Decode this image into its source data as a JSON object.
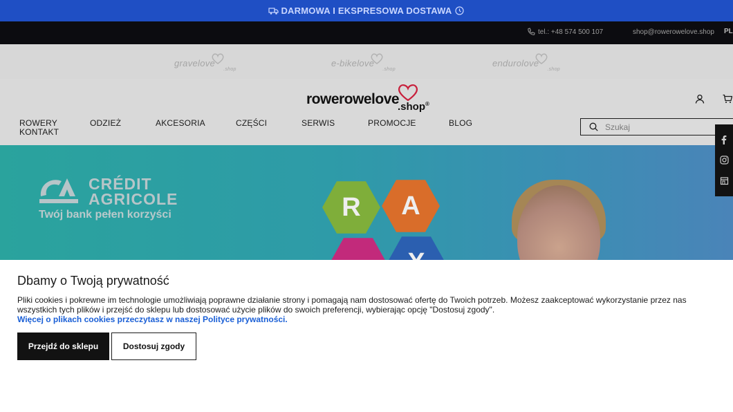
{
  "promo_bar": {
    "text": "DARMOWA I EKSPRESOWA DOSTAWA",
    "left_icon": "truck-icon",
    "right_icon": "clock-icon"
  },
  "contact_bar": {
    "phone": "tel.: +48 574 500 107",
    "email": "shop@rowerowelove.shop",
    "language": "PL"
  },
  "brands": [
    {
      "name": "gravelove",
      "suffix": ".shop"
    },
    {
      "name": "e-bikelove",
      "suffix": ".shop"
    },
    {
      "name": "endurolove",
      "suffix": ".shop"
    }
  ],
  "header": {
    "logo_text": "rowerowelove",
    "logo_suffix": ".shop",
    "logo_mark": "®",
    "account_icon": "user-icon",
    "cart_icon": "cart-icon"
  },
  "nav": {
    "rowery": "ROWERY",
    "kontakt": "KONTAKT",
    "odziez": "ODZIEŻ",
    "akcesoria": "AKCESORIA",
    "czesci": "CZĘŚCI",
    "serwis": "SERWIS",
    "promocje": "PROMOCJE",
    "blog": "BLOG"
  },
  "search": {
    "placeholder": "Szukaj"
  },
  "social": [
    "facebook-icon",
    "instagram-icon",
    "store-icon"
  ],
  "banner": {
    "brand_line1": "CRÉDIT",
    "brand_line2": "AGRICOLE",
    "tagline": "Twój bank pełen korzyści",
    "letters": [
      "R",
      "A",
      "",
      "X"
    ]
  },
  "cookie": {
    "title": "Dbamy o Twoją prywatność",
    "text": "Pliki cookies i pokrewne im technologie umożliwiają poprawne działanie strony i pomagają nam dostosować ofertę do Twoich potrzeb. Możesz zaakceptować wykorzystanie przez nas wszystkich tych plików i przejść do sklepu lub dostosować użycie plików do swoich preferencji, wybierając opcję \"Dostosuj zgody\".",
    "link": "Więcej o plikach cookies przeczytasz w naszej Polityce prywatności.",
    "accept_label": "Przejdź do sklepu",
    "customize_label": "Dostosuj zgody"
  },
  "colors": {
    "promo_bg": "#1f4fc4",
    "link": "#1a5fd6",
    "heart": "#c8203c",
    "banner_teal": "#2aa39d"
  }
}
